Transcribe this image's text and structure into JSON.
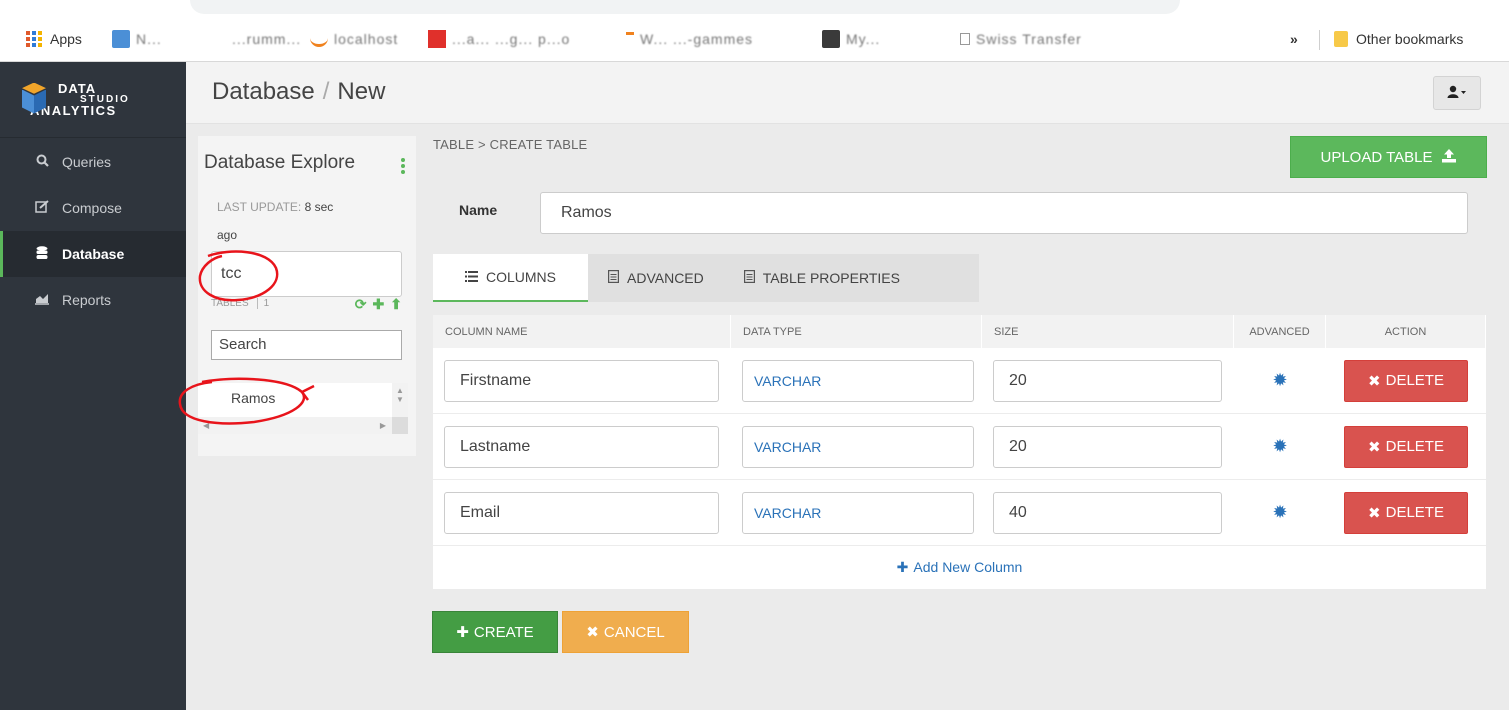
{
  "browser": {
    "bookmarks": [
      {
        "label": "Apps",
        "icon": "apps-grid-icon"
      },
      {
        "label": "N..."
      },
      {
        "label": "...rumm..."
      },
      {
        "label": "localhost"
      },
      {
        "label": "...a... ...g... p...o"
      },
      {
        "label": "W... ...-gammes"
      },
      {
        "label": "My..."
      },
      {
        "label": "Swiss Transfer"
      }
    ],
    "overflow_label": "»",
    "other_bookmarks": "Other bookmarks"
  },
  "sidebar": {
    "logo": {
      "line1": "DATA",
      "line2": "STUDIO",
      "line3": "ANALYTICS"
    },
    "items": [
      {
        "label": "Queries",
        "icon": "search-icon"
      },
      {
        "label": "Compose",
        "icon": "edit-icon"
      },
      {
        "label": "Database",
        "icon": "database-icon",
        "active": true
      },
      {
        "label": "Reports",
        "icon": "area-chart-icon"
      }
    ]
  },
  "header": {
    "crumb_root": "Database",
    "crumb_sep": "/",
    "crumb_current": "New"
  },
  "explorer": {
    "title": "Database Explore",
    "last_update_label": "LAST UPDATE:",
    "last_update_value": "8 sec",
    "last_update_tail": "ago",
    "database_value": "tcc",
    "tables_label": "TABLES",
    "tables_count": "1",
    "search_placeholder": "Search",
    "tables": [
      "Ramos"
    ]
  },
  "main": {
    "subcrumb": "TABLE > CREATE TABLE",
    "upload_label": "UPLOAD TABLE",
    "name_label": "Name",
    "name_value": "Ramos",
    "tabs": [
      {
        "label": "COLUMNS",
        "icon": "list-icon",
        "active": true
      },
      {
        "label": "ADVANCED",
        "icon": "document-icon"
      },
      {
        "label": "TABLE PROPERTIES",
        "icon": "document-icon"
      }
    ],
    "columns_header": [
      "COLUMN NAME",
      "DATA TYPE",
      "SIZE",
      "ADVANCED",
      "ACTION"
    ],
    "rows": [
      {
        "name": "Firstname",
        "type": "VARCHAR",
        "size": "20",
        "action": "DELETE"
      },
      {
        "name": "Lastname",
        "type": "VARCHAR",
        "size": "20",
        "action": "DELETE"
      },
      {
        "name": "Email",
        "type": "VARCHAR",
        "size": "40",
        "action": "DELETE"
      }
    ],
    "add_column_label": "Add New Column",
    "create_label": "CREATE",
    "cancel_label": "CANCEL"
  },
  "colors": {
    "sidebar_bg": "#2f353d",
    "success": "#5cb85c",
    "danger": "#d9534f",
    "warning": "#f0ad4e",
    "link": "#2a72b8",
    "annotation": "#e8141b"
  }
}
